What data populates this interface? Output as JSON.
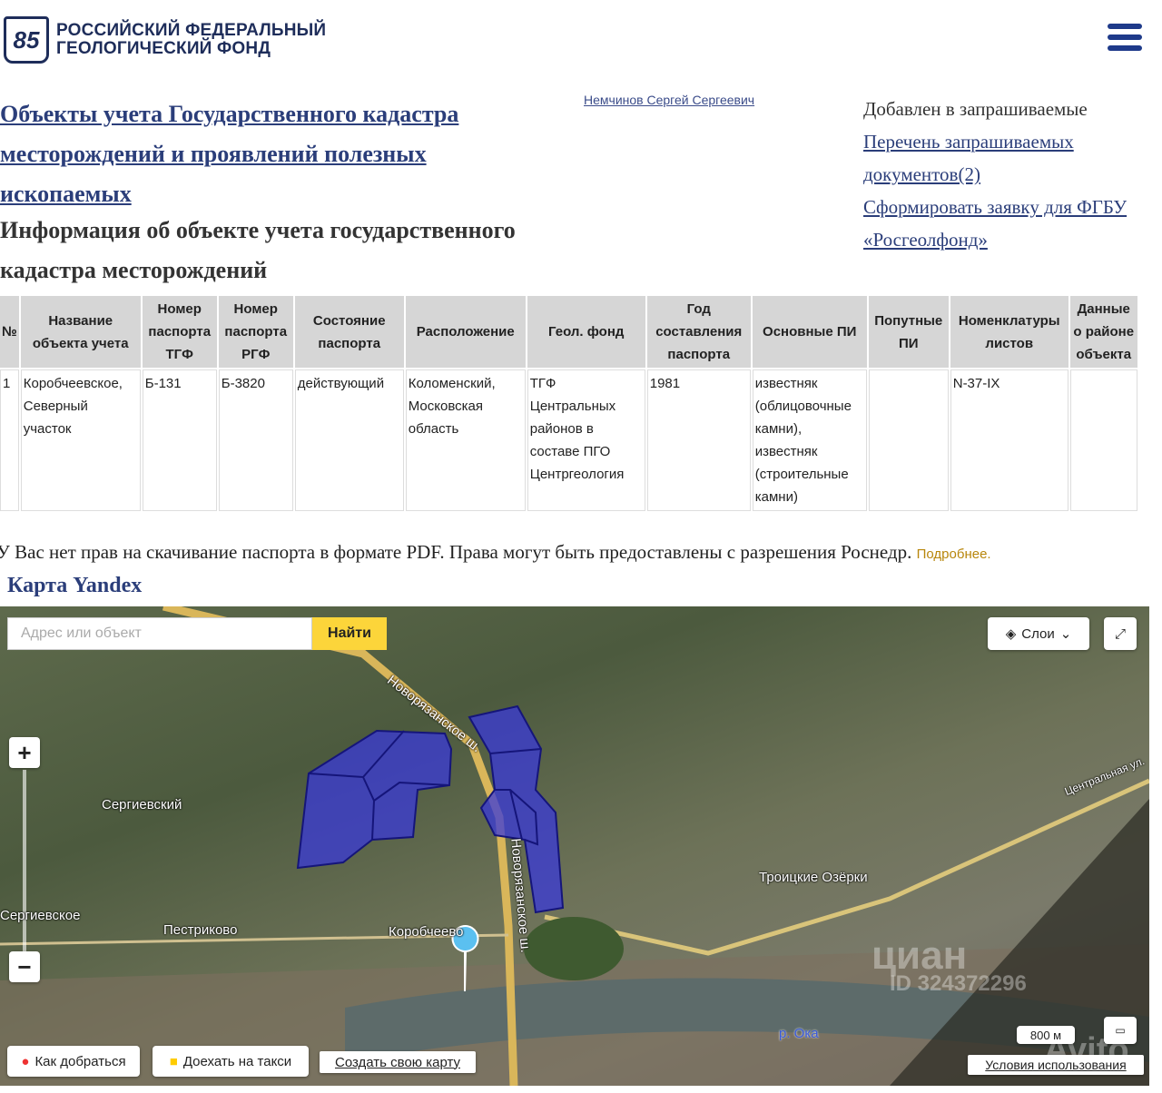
{
  "header": {
    "logo_number": "85",
    "logo_line1": "РОССИЙСКИЙ ФЕДЕРАЛЬНЫЙ",
    "logo_line2": "ГЕОЛОГИЧЕСКИЙ ФОНД"
  },
  "breadcrumb_link": "Объекты учета Государственного кадастра месторождений и проявлений полезных ископаемых",
  "page_title": "Информация об объекте учета государственного кадастра месторождений",
  "user_name": "Немчинов Сергей Сергеевич",
  "sidebar": {
    "added_text": "Добавлен в запрашиваемые",
    "list_link": "Перечень запрашиваемых документов(2)",
    "request_link": "Сформировать заявку для ФГБУ «Росгеолфонд»"
  },
  "table": {
    "headers": [
      "№",
      "Название объекта учета",
      "Номер паспорта ТГФ",
      "Номер паспорта РГФ",
      "Состояние паспорта",
      "Расположение",
      "Геол. фонд",
      "Год составления паспорта",
      "Основные ПИ",
      "Попутные ПИ",
      "Номенклатуры листов",
      "Данные о районе объекта"
    ],
    "rows": [
      [
        "1",
        "Коробчеевское, Северный участок",
        "Б-131",
        "Б-3820",
        "действующий",
        "Коломенский, Московская область",
        "ТГФ Центральных районов в составе ПГО Центргеология",
        "1981",
        "известняк (облицовочные камни), известняк (строительные камни)",
        "",
        "N-37-IX",
        ""
      ]
    ]
  },
  "note": {
    "text": "У Вас нет прав на скачивание паспорта в формате PDF. Права могут быть предоставлены с разрешения Роснедр.",
    "more": "Подробнее."
  },
  "map": {
    "title": "Карта Yandex",
    "search_placeholder": "Адрес или объект",
    "find_label": "Найти",
    "layers_label": "Слои",
    "zoom_in": "+",
    "zoom_out": "−",
    "route_label": "Как добраться",
    "taxi_label": "Доехать на такси",
    "create_label": "Создать свою карту",
    "scale_label": "800 м",
    "terms_label": "Условия использования",
    "labels": {
      "road": "Новорязанское ш.",
      "road2": "Новорязанское ш.",
      "sergievsky": "Сергиевский",
      "sergievskoe": "Сергиевское",
      "pestrikovo": "Пестриково",
      "korobcheevo": "Коробчеево",
      "troitskie": "Троицкие Озёрки",
      "oka": "р. Ока",
      "central": "Центральная ул."
    },
    "watermarks": {
      "cian": "циан",
      "cian_id": "ID 324372296",
      "avito": "Avito"
    },
    "polygon_color": "#3a3ad8"
  }
}
